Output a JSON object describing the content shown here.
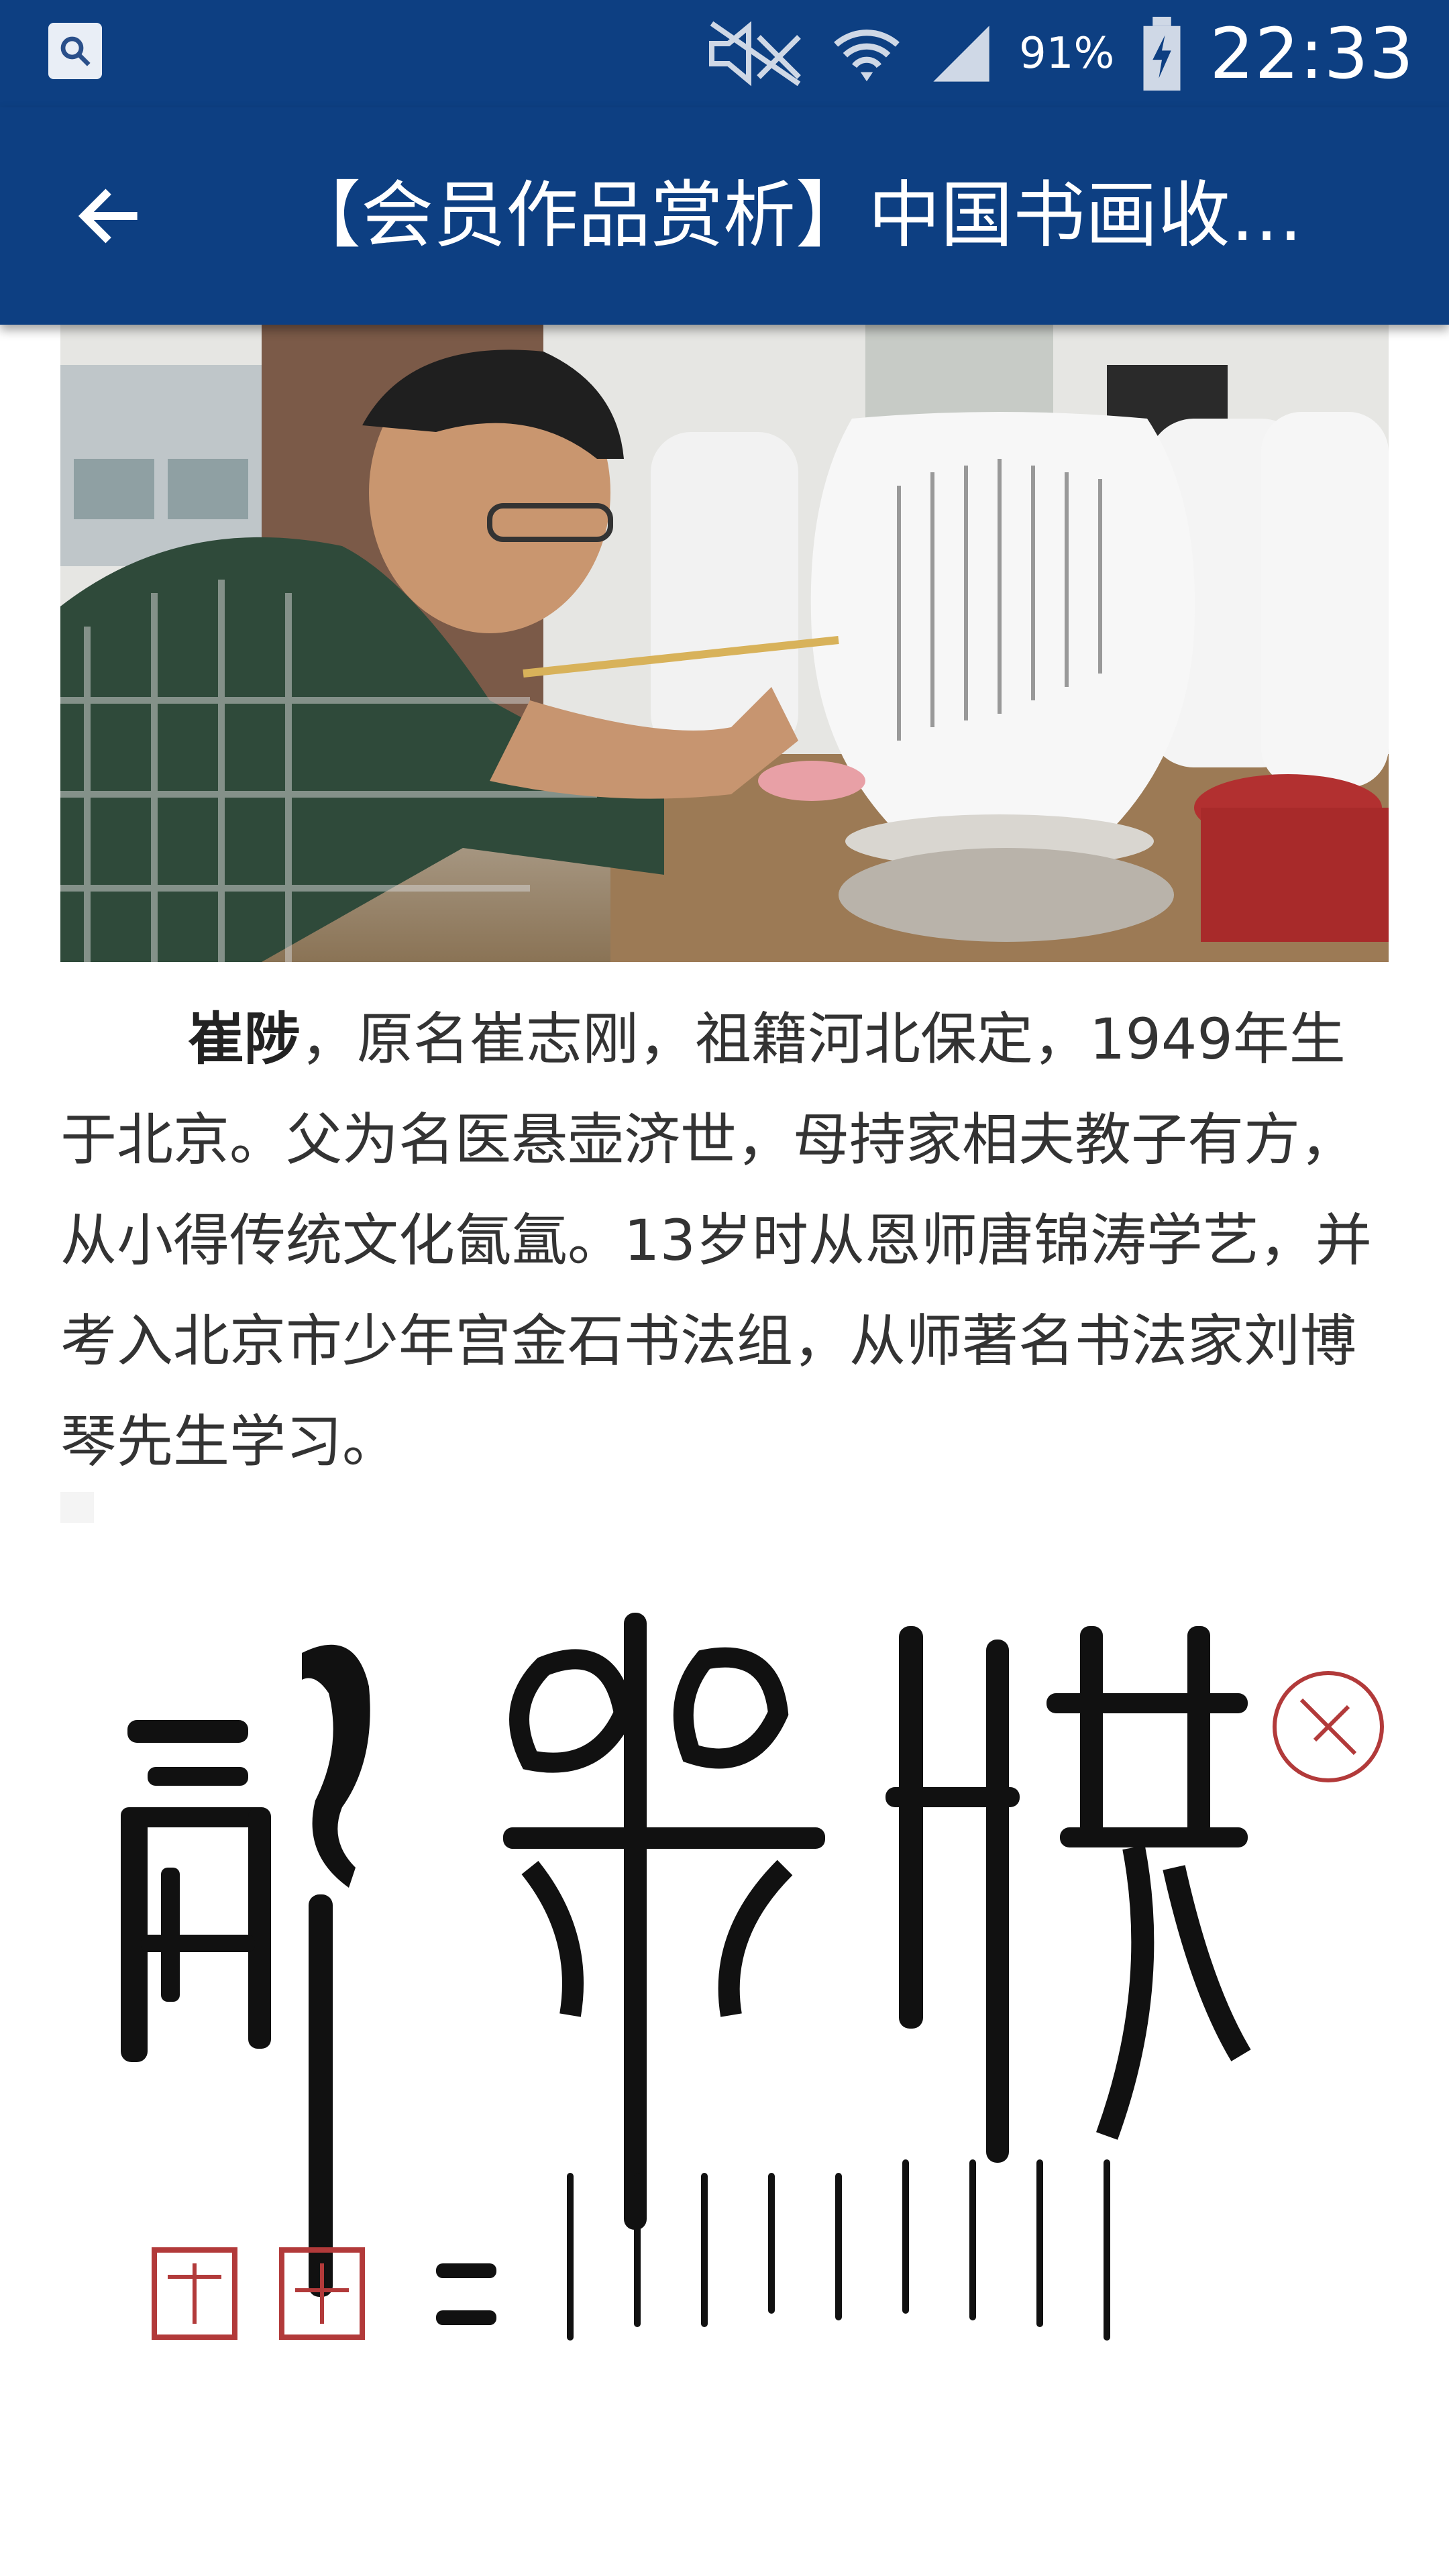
{
  "status_bar": {
    "battery_percent": "91%",
    "time": "22:33",
    "icons": [
      "search-notification-icon",
      "mute-icon",
      "wifi-icon",
      "signal-icon",
      "battery-charging-icon"
    ]
  },
  "app_bar": {
    "title": "【会员作品赏析】中国书画收…",
    "back_icon": "arrow-left-icon"
  },
  "article": {
    "bio": {
      "name": "崔陟",
      "text": "，原名崔志刚，祖籍河北保定，1949年生于北京。父为名医悬壶济世，母持家相夫教子有方，从小得传统文化氤氲。13岁时从恩师唐锦涛学艺，并考入北京市少年宫金石书法组，从师著名书法家刘博琴先生学习。"
    }
  },
  "colors": {
    "primary": "#0d3f82",
    "text": "#333333"
  }
}
